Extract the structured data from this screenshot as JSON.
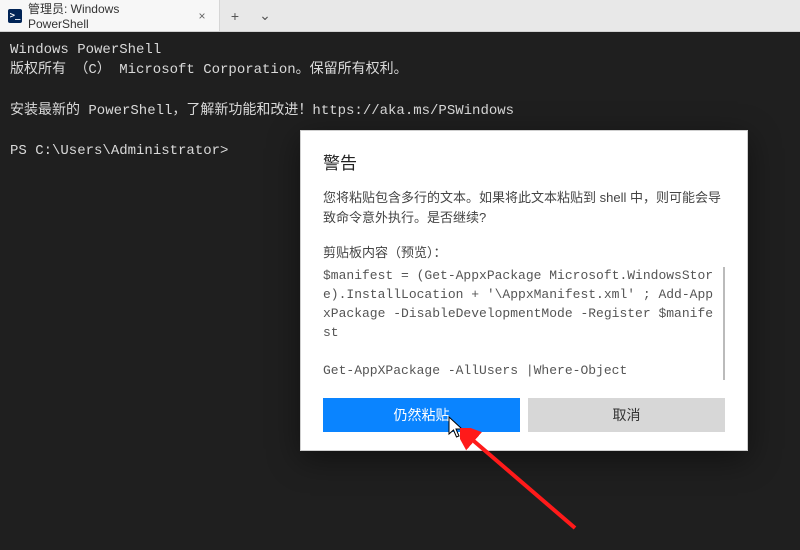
{
  "tab": {
    "icon_glyph": ">_",
    "title": "管理员: Windows PowerShell"
  },
  "tab_actions": {
    "new_tab_glyph": "+",
    "dropdown_glyph": "⌄",
    "close_glyph": "×"
  },
  "terminal": {
    "line1": "Windows PowerShell",
    "line2": "版权所有 （C） Microsoft Corporation。保留所有权利。",
    "line3": "安装最新的 PowerShell，了解新功能和改进！https://aka.ms/PSWindows",
    "prompt": "PS C:\\Users\\Administrator>"
  },
  "dialog": {
    "title": "警告",
    "message": "您将粘贴包含多行的文本。如果将此文本粘贴到 shell 中，则可能会导致命令意外执行。是否继续?",
    "preview_label": "剪贴板内容（预览）：",
    "preview_text": "$manifest = (Get-AppxPackage Microsoft.WindowsStore).InstallLocation + '\\AppxManifest.xml' ; Add-AppxPackage -DisableDevelopmentMode -Register $manifest\n\nGet-AppXPackage -AllUsers |Where-Object",
    "primary_label": "仍然粘贴",
    "secondary_label": "取消"
  }
}
